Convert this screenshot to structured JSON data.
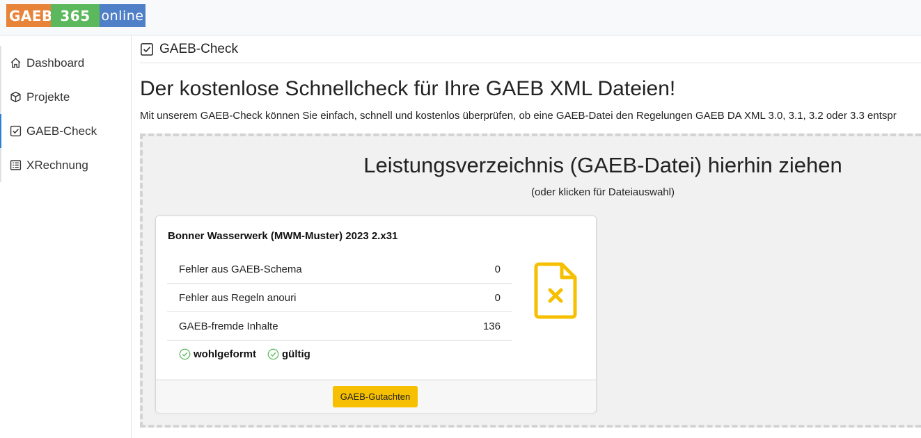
{
  "logo": {
    "part1": "GAEB",
    "part2": "365",
    "part3": "online"
  },
  "sidebar": {
    "items": [
      {
        "label": "Dashboard",
        "icon": "house-icon"
      },
      {
        "label": "Projekte",
        "icon": "box-icon"
      },
      {
        "label": "GAEB-Check",
        "icon": "check-square-icon",
        "active": true
      },
      {
        "label": "XRechnung",
        "icon": "receipt-icon"
      }
    ]
  },
  "header": {
    "title": "GAEB-Check"
  },
  "main": {
    "headline": "Der kostenlose Schnellcheck für Ihre GAEB XML Dateien!",
    "subline": "Mit unserem GAEB-Check können Sie einfach, schnell und kostenlos überprüfen, ob eine GAEB-Datei den Regelungen GAEB DA XML 3.0, 3.1, 3.2 oder 3.3 entspr"
  },
  "dropzone": {
    "title": "Leistungsverzeichnis (GAEB-Datei) hierhin ziehen",
    "subtitle": "(oder klicken für Dateiauswahl)"
  },
  "result_card": {
    "title": "Bonner Wasserwerk (MWM-Muster) 2023 2.x31",
    "rows": [
      {
        "label": "Fehler aus GAEB-Schema",
        "value": "0"
      },
      {
        "label": "Fehler aus Regeln anouri",
        "value": "0"
      },
      {
        "label": "GAEB-fremde Inhalte",
        "value": "136"
      }
    ],
    "status": {
      "wellformed": "wohlgeformt",
      "valid": "gültig"
    },
    "button_label": "GAEB-Gutachten"
  },
  "colors": {
    "accent": "#2d7fd3",
    "warning_yellow": "#f6c000",
    "success_green": "#5cb85c",
    "logo_orange": "#e8833a",
    "logo_blue": "#4f7fc7"
  }
}
